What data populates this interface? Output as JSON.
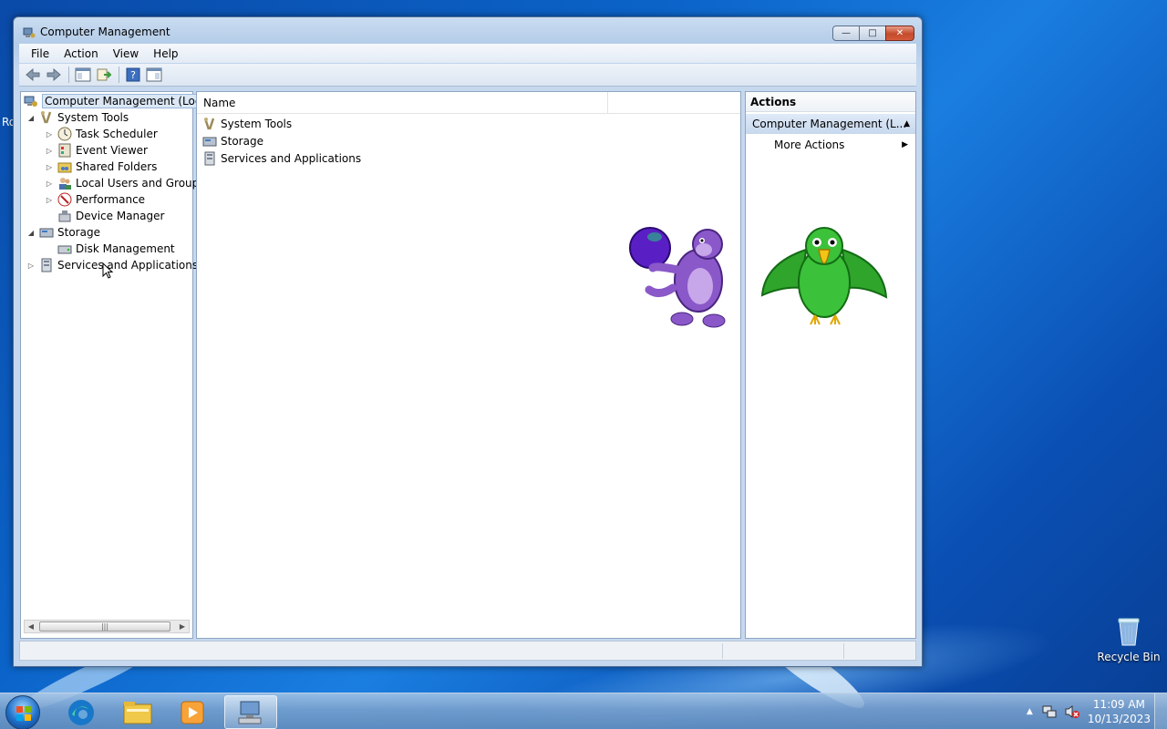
{
  "window": {
    "title": "Computer Management",
    "buttons": {
      "minimize": "—",
      "maximize": "□",
      "close": "✕"
    }
  },
  "menubar": [
    "File",
    "Action",
    "View",
    "Help"
  ],
  "toolbar": {
    "icons": [
      "back-arrow-icon",
      "forward-arrow-icon",
      "show-hide-console-tree-icon",
      "export-list-icon",
      "help-icon",
      "show-hide-action-pane-icon"
    ]
  },
  "tree": {
    "root": "Computer Management (Local",
    "system_tools": "System Tools",
    "task_scheduler": "Task Scheduler",
    "event_viewer": "Event Viewer",
    "shared_folders": "Shared Folders",
    "local_users": "Local Users and Groups",
    "performance": "Performance",
    "device_manager": "Device Manager",
    "storage": "Storage",
    "disk_management": "Disk Management",
    "services_apps": "Services and Applications",
    "scroll_grip": "|||"
  },
  "list": {
    "header_name": "Name",
    "items": [
      "System Tools",
      "Storage",
      "Services and Applications"
    ]
  },
  "actions": {
    "header": "Actions",
    "section": "Computer Management (L...",
    "more_actions": "More Actions"
  },
  "desktop": {
    "recycle_bin": "Recycle Bin",
    "edge_text_left": "Ro"
  },
  "taskbar": {
    "time": "11:09 AM",
    "date": "10/13/2023"
  },
  "colors": {
    "desktop_blue": "#0b63c8",
    "selection": "#dbe7f5",
    "actions_section": "#c7d8ee"
  }
}
